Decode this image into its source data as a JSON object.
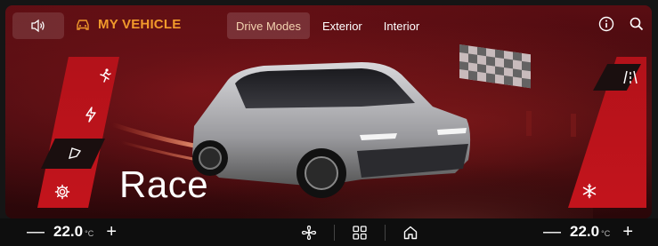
{
  "header": {
    "volume_icon": "speaker-icon",
    "brand_icon": "car-icon",
    "title": "MY VEHICLE",
    "tabs": [
      {
        "label": "Drive Modes",
        "active": true
      },
      {
        "label": "Exterior",
        "active": false
      },
      {
        "label": "Interior",
        "active": false
      }
    ],
    "info_icon": "info-icon",
    "search_icon": "search-icon"
  },
  "left_menu": {
    "items": [
      {
        "icon": "running-person-icon",
        "selected": false
      },
      {
        "icon": "lightning-bolt-icon",
        "selected": false
      },
      {
        "icon": "flag-icon",
        "selected": true
      },
      {
        "icon": "gear-icon",
        "selected": false
      }
    ]
  },
  "right_menu": {
    "items": [
      {
        "icon": "road-lane-icon",
        "selected": true
      },
      {
        "icon": "snowflake-icon",
        "selected": false
      }
    ]
  },
  "main": {
    "mode_label": "Race"
  },
  "bottom_bar": {
    "left_temp": "22.0",
    "right_temp": "22.0",
    "unit": "°C",
    "minus": "—",
    "plus": "+",
    "center_icons": [
      "fan-icon",
      "grid-icon",
      "home-icon"
    ]
  },
  "colors": {
    "accent": "#f19a2b",
    "panel_red": "#c3141c",
    "background": "#3d0a0e"
  }
}
